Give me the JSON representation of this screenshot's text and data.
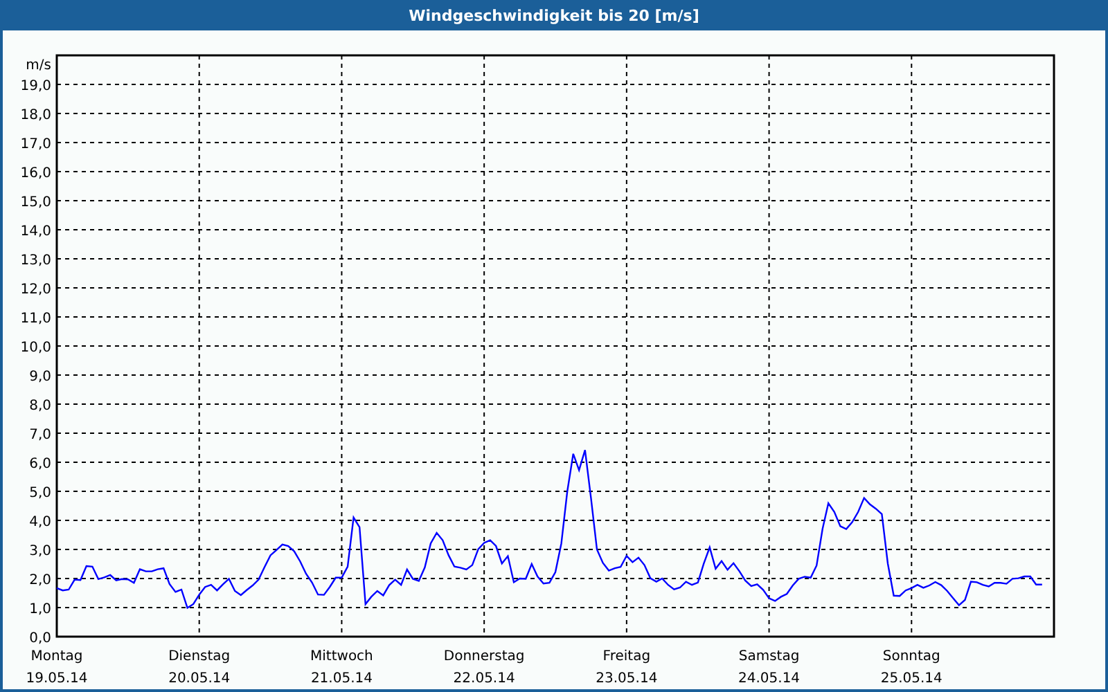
{
  "chart_data": {
    "type": "line",
    "title": "Windgeschwindigkeit bis 20 [m/s]",
    "ylabel": "m/s",
    "categories": [
      "Montag 19.05.14",
      null,
      null,
      null,
      null,
      null,
      null,
      null,
      null,
      null,
      null,
      null,
      null,
      null,
      null,
      null,
      null,
      null,
      null,
      null,
      null,
      null,
      null,
      null,
      "Dienstag 20.05.14",
      null,
      null,
      null,
      null,
      null,
      null,
      null,
      null,
      null,
      null,
      null,
      null,
      null,
      null,
      null,
      null,
      null,
      null,
      null,
      null,
      null,
      null,
      null,
      "Mittwoch 21.05.14",
      null,
      null,
      null,
      null,
      null,
      null,
      null,
      null,
      null,
      null,
      null,
      null,
      null,
      null,
      null,
      null,
      null,
      null,
      null,
      null,
      null,
      null,
      null,
      "Donnerstag 22.05.14",
      null,
      null,
      null,
      null,
      null,
      null,
      null,
      null,
      null,
      null,
      null,
      null,
      null,
      null,
      null,
      null,
      null,
      null,
      null,
      null,
      null,
      null,
      null,
      "Freitag 23.05.14",
      null,
      null,
      null,
      null,
      null,
      null,
      null,
      null,
      null,
      null,
      null,
      null,
      null,
      null,
      null,
      null,
      null,
      null,
      null,
      null,
      null,
      null,
      null,
      "Samstag 24.05.14",
      null,
      null,
      null,
      null,
      null,
      null,
      null,
      null,
      null,
      null,
      null,
      null,
      null,
      null,
      null,
      null,
      null,
      null,
      null,
      null,
      null,
      null,
      null,
      "Sonntag 25.05.14",
      null,
      null,
      null,
      null,
      null,
      null,
      null,
      null,
      null,
      null,
      null,
      null,
      null,
      null,
      null,
      null,
      null,
      null,
      null,
      null,
      null,
      null,
      null,
      null
    ],
    "series": [
      {
        "color": "#0000ff",
        "values": [
          1.67,
          1.59,
          1.62,
          1.96,
          1.95,
          2.43,
          2.41,
          1.98,
          2.04,
          2.12,
          1.94,
          1.98,
          1.97,
          1.85,
          2.32,
          2.25,
          2.25,
          2.32,
          2.35,
          1.81,
          1.54,
          1.62,
          0.99,
          1.12,
          1.45,
          1.71,
          1.78,
          1.59,
          1.8,
          1.99,
          1.57,
          1.43,
          1.6,
          1.76,
          1.96,
          2.39,
          2.8,
          2.98,
          3.17,
          3.12,
          2.94,
          2.59,
          2.16,
          1.86,
          1.45,
          1.44,
          1.71,
          2.03,
          2.03,
          2.41,
          4.1,
          3.76,
          1.12,
          1.37,
          1.57,
          1.42,
          1.77,
          1.96,
          1.78,
          2.31,
          1.99,
          1.92,
          2.38,
          3.21,
          3.57,
          3.32,
          2.8,
          2.41,
          2.37,
          2.31,
          2.46,
          3.01,
          3.23,
          3.32,
          3.12,
          2.52,
          2.77,
          1.87,
          2,
          1.99,
          2.5,
          2.07,
          1.83,
          1.85,
          2.22,
          3.21,
          5,
          6.29,
          5.73,
          6.42,
          4.77,
          3,
          2.54,
          2.27,
          2.35,
          2.4,
          2.78,
          2.56,
          2.72,
          2.46,
          2.01,
          1.89,
          2,
          1.78,
          1.63,
          1.69,
          1.89,
          1.78,
          1.86,
          2.51,
          3.07,
          2.34,
          2.6,
          2.3,
          2.53,
          2.25,
          1.93,
          1.74,
          1.8,
          1.61,
          1.32,
          1.23,
          1.37,
          1.47,
          1.76,
          1.99,
          2.06,
          2.03,
          2.45,
          3.71,
          4.59,
          4.29,
          3.8,
          3.7,
          3.94,
          4.29,
          4.77,
          4.55,
          4.4,
          4.22,
          2.52,
          1.41,
          1.4,
          1.59,
          1.67,
          1.78,
          1.68,
          1.76,
          1.88,
          1.77,
          1.57,
          1.33,
          1.08,
          1.26,
          1.89,
          1.87,
          1.78,
          1.73,
          1.85,
          1.85,
          1.82,
          1.99,
          2.01,
          2.07,
          2.07,
          1.79,
          1.79,
          null,
          null
        ]
      }
    ],
    "grid": true,
    "ylim": [
      0,
      20
    ],
    "yticks": [
      {
        "value": 0,
        "label": "0,0"
      },
      {
        "value": 1,
        "label": "1,0"
      },
      {
        "value": 2,
        "label": "2,0"
      },
      {
        "value": 3,
        "label": "3,0"
      },
      {
        "value": 4,
        "label": "4,0"
      },
      {
        "value": 5,
        "label": "5,0"
      },
      {
        "value": 6,
        "label": "6,0"
      },
      {
        "value": 7,
        "label": "7,0"
      },
      {
        "value": 8,
        "label": "8,0"
      },
      {
        "value": 9,
        "label": "9,0"
      },
      {
        "value": 10,
        "label": "10,0"
      },
      {
        "value": 11,
        "label": "11,0"
      },
      {
        "value": 12,
        "label": "12,0"
      },
      {
        "value": 13,
        "label": "13,0"
      },
      {
        "value": 14,
        "label": "14,0"
      },
      {
        "value": 15,
        "label": "15,0"
      },
      {
        "value": 16,
        "label": "16,0"
      },
      {
        "value": 17,
        "label": "17,0"
      },
      {
        "value": 18,
        "label": "18,0"
      },
      {
        "value": 19,
        "label": "19,0"
      }
    ]
  }
}
